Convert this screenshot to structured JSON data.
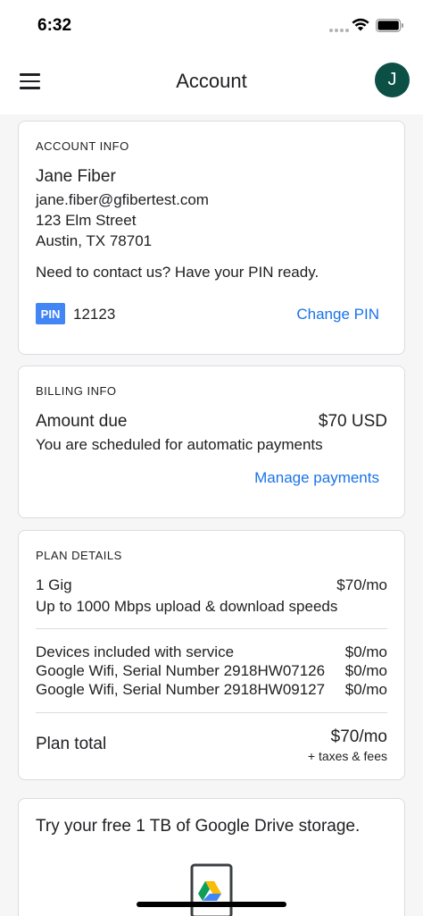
{
  "status": {
    "time": "6:32"
  },
  "header": {
    "title": "Account",
    "avatar_initial": "J"
  },
  "account": {
    "label": "ACCOUNT INFO",
    "name": "Jane Fiber",
    "email": "jane.fiber@gfibertest.com",
    "street": "123 Elm Street",
    "city": "Austin, TX 78701",
    "contact_note": "Need to contact us? Have your PIN ready.",
    "pin_badge": "PIN",
    "pin_value": "12123",
    "change_pin": "Change PIN"
  },
  "billing": {
    "label": "BILLING INFO",
    "amount_label": "Amount due",
    "amount_value": "$70 USD",
    "note": "You are scheduled for automatic payments",
    "manage": "Manage payments"
  },
  "plan": {
    "label": "PLAN DETAILS",
    "name": "1 Gig",
    "price": "$70/mo",
    "desc": "Up to 1000 Mbps upload & download speeds",
    "devices_label": "Devices included with service",
    "devices_price": "$0/mo",
    "devices": [
      {
        "name": "Google Wifi, Serial Number 2918HW07126",
        "price": "$0/mo"
      },
      {
        "name": "Google Wifi, Serial Number 2918HW09127",
        "price": "$0/mo"
      }
    ],
    "total_label": "Plan total",
    "total_value": "$70/mo",
    "total_note": "+ taxes & fees"
  },
  "promo": {
    "title": "Try your free 1 TB of Google Drive storage."
  },
  "colors": {
    "avatar": "#0b4f45",
    "link": "#1a73e8",
    "pin_badge": "#4285f4"
  }
}
